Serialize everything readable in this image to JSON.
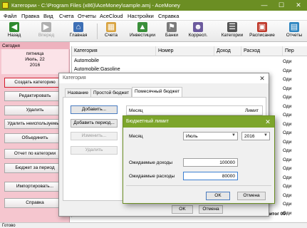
{
  "window": {
    "title": "Категории - C:\\Program Files (x86)\\AceMoney\\sample.amj - AceMoney"
  },
  "menu": [
    "Файл",
    "Правка",
    "Вид",
    "Счета",
    "Отчеты",
    "AceCloud",
    "Настройки",
    "Справка"
  ],
  "toolbar": {
    "back": "Назад",
    "forward": "Вперед",
    "home": "Главная",
    "accounts": "Счета",
    "investments": "Инвестиции",
    "banks": "Банки",
    "payees": "Корресп.",
    "categories": "Категории",
    "schedule": "Расписание",
    "reports": "Отчеты"
  },
  "left_panel": {
    "today_label": "Сегодня",
    "weekday": "пятница",
    "date_line": "Июль, 22",
    "year": "2016",
    "buttons": [
      "Создать категорию",
      "Редактировать",
      "Удалить",
      "Удалить неиспользуемые",
      "Объединить",
      "Отчет по категории",
      "Бюджет за период",
      "Импортировать...",
      "Справка"
    ]
  },
  "table": {
    "columns": [
      "Категория",
      "Номер",
      "Доход",
      "Расход",
      "Пер"
    ],
    "rows": [
      "Automobile",
      "Automobile:Gasoline"
    ],
    "right_col_values": [
      "Оди",
      "Оди",
      "Оди",
      "Оди",
      "Оди",
      "Оди",
      "Оди",
      "Оди",
      "Оди",
      "Оди",
      "Оди",
      "Оди",
      "Оди",
      "Оди",
      "Оди",
      "Оди",
      "Оди",
      "Оди"
    ],
    "total_label": "итог",
    "total_value": "00"
  },
  "category_dialog": {
    "title": "Категория",
    "tabs": [
      "Название",
      "Простой бюджет",
      "Помесячный бюджет"
    ],
    "add_button": "Добавить...",
    "add_period_button": "Добавить период...",
    "edit_button": "Изменить...",
    "delete_button": "Удалить",
    "grid_month": "Месяц",
    "grid_limit": "Лимит",
    "ok": "OK",
    "cancel": "Отмена"
  },
  "limit_dialog": {
    "title": "Бюджетный лимит",
    "month_label": "Месяц",
    "month_value": "Июль",
    "year_value": "2016",
    "expected_income_label": "Ожидаемые доходы",
    "expected_income_value": "100000",
    "expected_expense_label": "Ожидаемые расходы",
    "expected_expense_value": "80000",
    "ok": "OK",
    "cancel": "Отмена"
  },
  "status": {
    "text": "Готово"
  },
  "colors": {
    "title_bar": "#6b8e23",
    "left_panel": "#f5c6cf",
    "dialog_accent": "#7ca52b"
  }
}
